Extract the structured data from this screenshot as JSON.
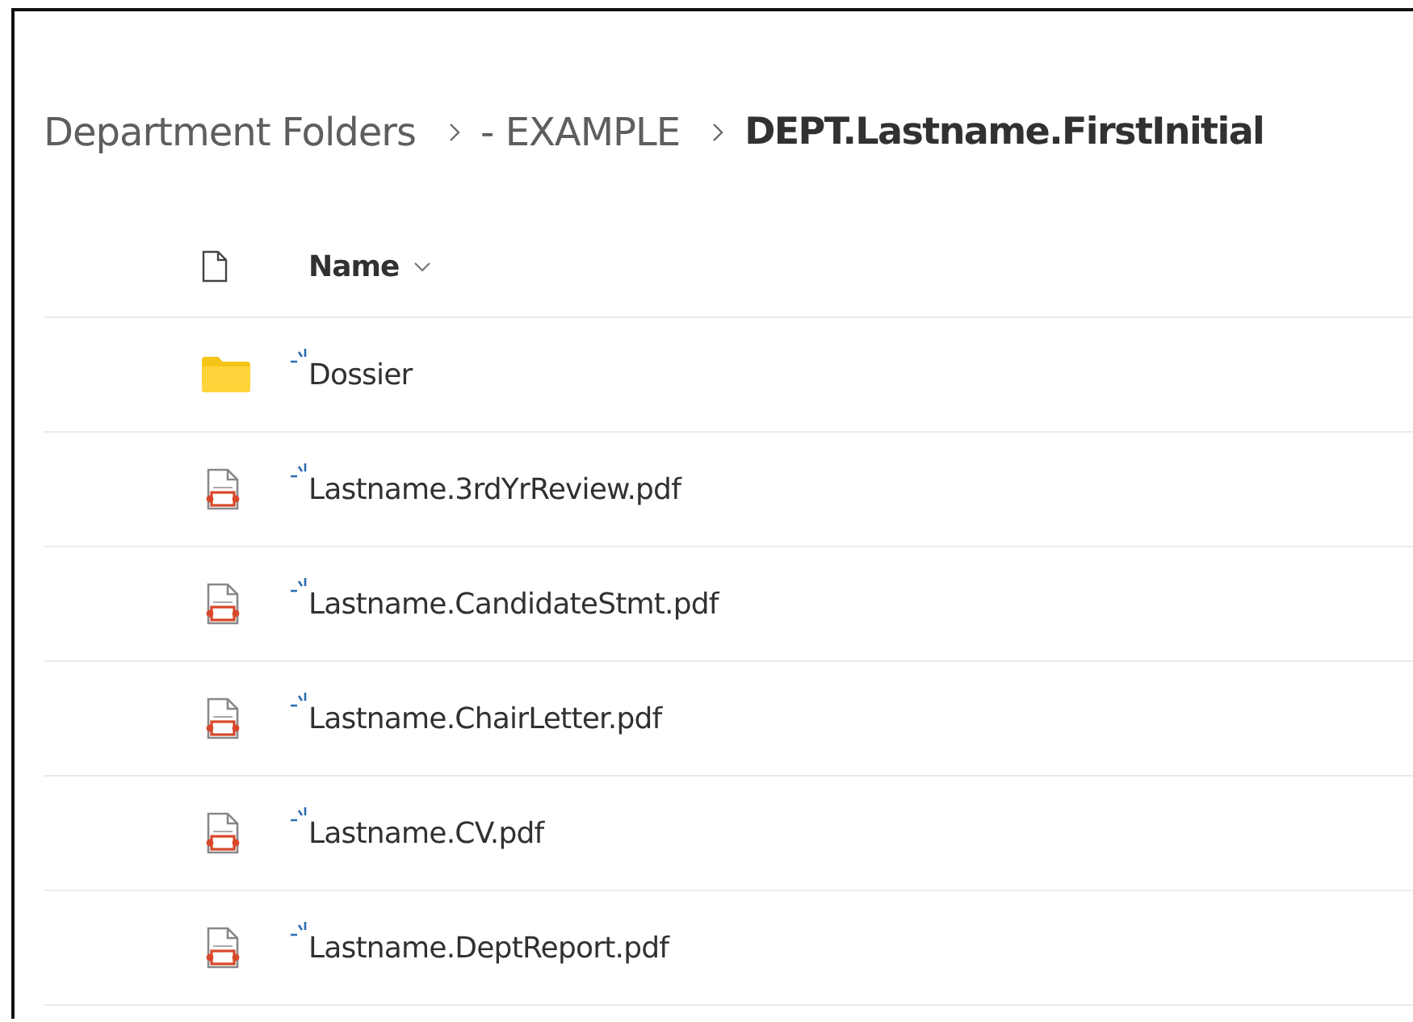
{
  "breadcrumb": [
    {
      "label": "Department Folders",
      "current": false
    },
    {
      "label": "- EXAMPLE",
      "current": false
    },
    {
      "label": "DEPT.Lastname.FirstInitial",
      "current": true
    }
  ],
  "table": {
    "columns": [
      {
        "label": "Name"
      }
    ],
    "rows": [
      {
        "kind": "folder",
        "name": "Dossier",
        "new": true
      },
      {
        "kind": "pdf",
        "name": "Lastname.3rdYrReview.pdf",
        "new": true
      },
      {
        "kind": "pdf",
        "name": "Lastname.CandidateStmt.pdf",
        "new": true
      },
      {
        "kind": "pdf",
        "name": "Lastname.ChairLetter.pdf",
        "new": true
      },
      {
        "kind": "pdf",
        "name": "Lastname.CV.pdf",
        "new": true
      },
      {
        "kind": "pdf",
        "name": "Lastname.DeptReport.pdf",
        "new": true
      }
    ]
  }
}
